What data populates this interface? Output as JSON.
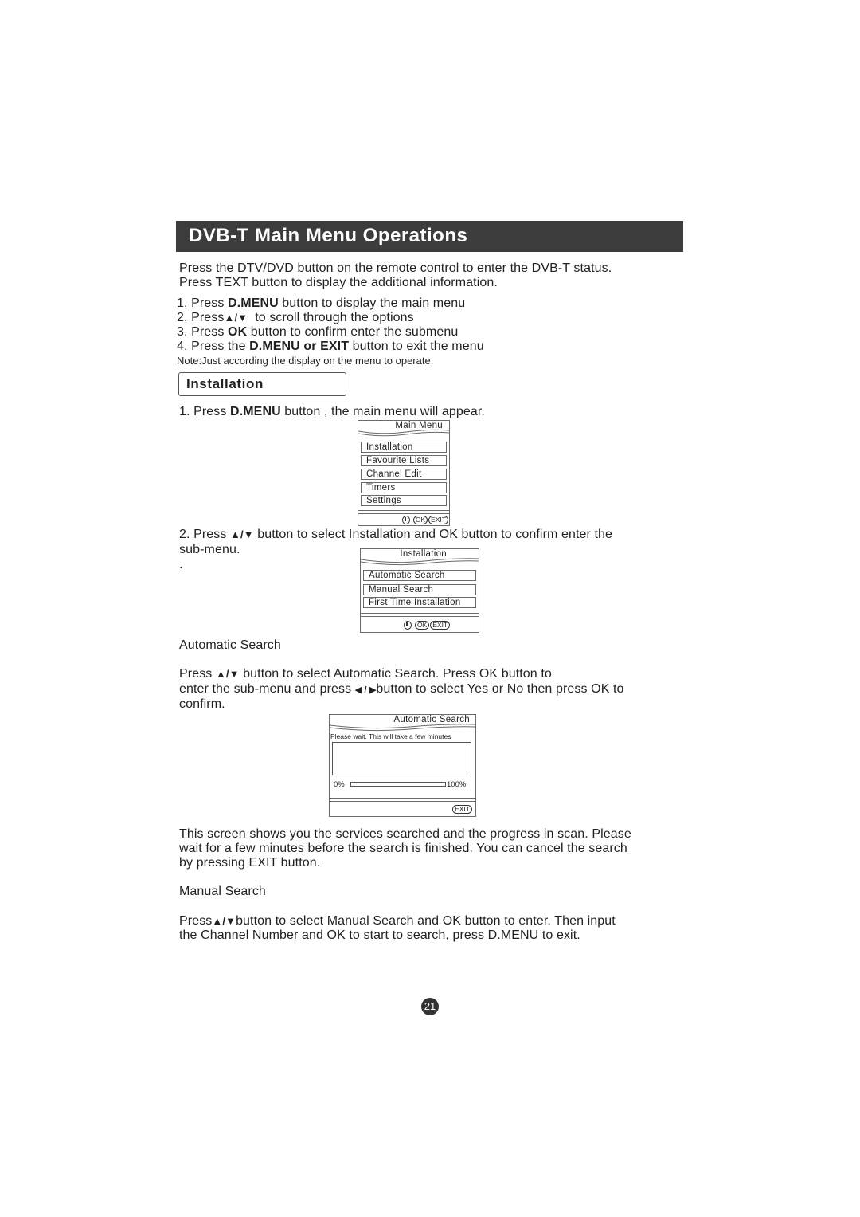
{
  "title": "DVB-T Main Menu Operations",
  "intro": {
    "line1": "Press the DTV/DVD button on the remote control to enter the DVB-T status.",
    "line2": "Press TEXT button to display the additional information."
  },
  "steps": [
    {
      "pre": "1. Press ",
      "bold": "D.MENU",
      "post": " button to display the main menu"
    },
    {
      "pre": "2. Press",
      "bold": "▲/▼",
      "post": "  to scroll through the options"
    },
    {
      "pre": "3. Press ",
      "bold": "OK",
      "post": " button to confirm enter the submenu"
    },
    {
      "pre": "4. Press the ",
      "bold": "D.MENU or EXIT",
      "post": " button to exit the menu"
    }
  ],
  "note": "Note:Just according the display on the menu to operate.",
  "section_heading": "Installation",
  "step_a": {
    "pre": "1. Press ",
    "bold": "D.MENU",
    "post": " button , the main menu will appear."
  },
  "main_menu": {
    "title": "Main Menu",
    "items": [
      "Installation",
      "Favourite Lists",
      "Channel Edit",
      "Timers",
      "Settings"
    ],
    "footer": {
      "ok": "OK",
      "exit": "EXIT"
    }
  },
  "step_b": {
    "pre": "2. Press ",
    "arrows": "▲/▼",
    "post": " button to select Installation and OK button to confirm enter the",
    "line2": "sub-menu.",
    "dot": "."
  },
  "installation_menu": {
    "title": "Installation",
    "items": [
      "Automatic Search",
      "Manual Search",
      "First Time Installation"
    ],
    "footer": {
      "ok": "OK",
      "exit": "EXIT"
    }
  },
  "automatic_search": {
    "heading": "Automatic Search",
    "line1_pre": "Press ",
    "line1_arrows": "▲/▼",
    "line1_post": " button to select Automatic Search. Press OK button to",
    "line2_pre": "enter the sub-menu and press ",
    "line2_arrows": "◀ / ▶",
    "line2_post": "button to select Yes or No then press OK to",
    "line3": "confirm."
  },
  "auto_search_screen": {
    "title": "Automatic Search",
    "message": "Please wait. This will take a few minutes",
    "progress_min": "0%",
    "progress_max": "100%",
    "progress_value": 0,
    "exit": "EXIT"
  },
  "scan_description": {
    "line1": "This screen shows you the services searched and the progress in scan. Please",
    "line2": "wait for a few minutes before the search is finished. You can cancel the search",
    "line3": "by pressing EXIT button."
  },
  "manual_search": {
    "heading": "Manual Search",
    "line1_pre": "Press",
    "line1_arrows": "▲/▼",
    "line1_post": "button to select Manual Search and OK button to enter. Then input",
    "line2": "the Channel Number and OK to start to search, press D.MENU to exit."
  },
  "page_number": "21"
}
